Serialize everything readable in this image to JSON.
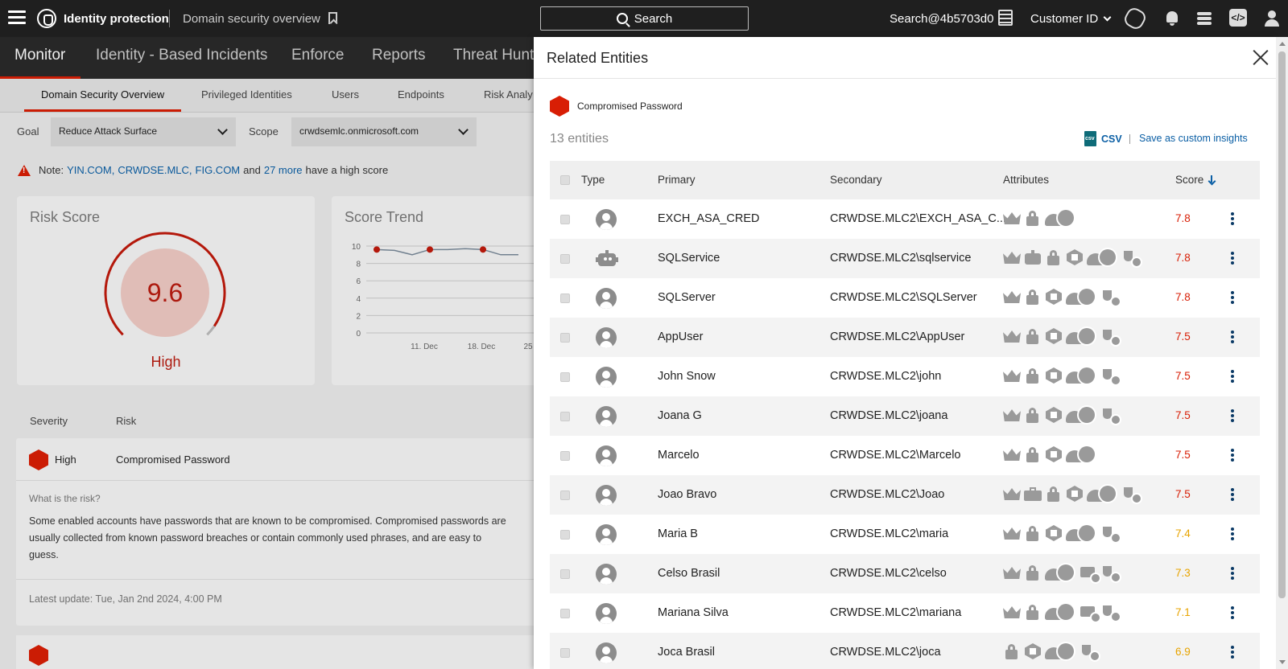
{
  "topbar": {
    "app_name": "Identity protection",
    "page": "Domain security overview",
    "search_label": "Search",
    "account": "Search@4b5703d0",
    "customer_id_label": "Customer ID"
  },
  "main_nav": [
    "Monitor",
    "Identity - Based Incidents",
    "Enforce",
    "Reports",
    "Threat Hunt"
  ],
  "sub_nav": [
    "Domain Security Overview",
    "Privileged Identities",
    "Users",
    "Endpoints",
    "Risk Analy"
  ],
  "filters": {
    "goal_label": "Goal",
    "goal_value": "Reduce Attack Surface",
    "scope_label": "Scope",
    "scope_value": "crwdsemlc.onmicrosoft.com"
  },
  "note": {
    "prefix": "Note:",
    "domain1": "YIN.COM,",
    "domain2": "CRWDSE.MLC,",
    "domain3": "FIG.COM",
    "and": "and",
    "more": "27 more",
    "suffix": "have a high score"
  },
  "risk_score": {
    "title": "Risk Score",
    "value": "9.6",
    "score": 9.6,
    "max": 10,
    "level": "High"
  },
  "score_trend": {
    "title": "Score Trend"
  },
  "chart_data": {
    "type": "line",
    "title": "Score Trend",
    "x": [
      "11. Dec",
      "18. Dec",
      "25"
    ],
    "ylim": [
      0,
      10
    ],
    "yticks": [
      0,
      2,
      4,
      6,
      8,
      10
    ],
    "series": [
      {
        "values": [
          9.6,
          9.5,
          9.0,
          9.6,
          9.6,
          9.7,
          9.6,
          9.0,
          9.0
        ]
      }
    ]
  },
  "risk_table": {
    "severity_header": "Severity",
    "risk_header": "Risk",
    "severity": "High",
    "risk": "Compromised Password",
    "question": "What is the risk?",
    "description": "Some enabled accounts have passwords that are known to be compromised. Compromised passwords are usually collected from known password breaches or contain commonly used phrases, and are easy to guess.",
    "update": "Latest update: Tue, Jan 2nd 2024, 4:00 PM"
  },
  "panel": {
    "title": "Related Entities",
    "filter_tag": "Compromised Password",
    "count": "13 entities",
    "csv_label": "CSV",
    "save_label": "Save as custom insights",
    "columns": {
      "type": "Type",
      "primary": "Primary",
      "secondary": "Secondary",
      "attributes": "Attributes",
      "score": "Score"
    },
    "rows": [
      {
        "type": "person",
        "primary": "EXCH_ASA_CRED",
        "secondary": "CRWDSE.MLC2\\EXCH_ASA_C...",
        "score": "7.8",
        "color": "#d81e05",
        "attrs": [
          "crown",
          "lock",
          "cloudcert"
        ]
      },
      {
        "type": "robot",
        "primary": "SQLService",
        "secondary": "CRWDSE.MLC2\\sqlservice",
        "score": "7.8",
        "color": "#d81e05",
        "attrs": [
          "crown",
          "bot",
          "lock",
          "hexweb",
          "cloudcert",
          "plug"
        ]
      },
      {
        "type": "person",
        "primary": "SQLServer",
        "secondary": "CRWDSE.MLC2\\SQLServer",
        "score": "7.8",
        "color": "#d81e05",
        "attrs": [
          "crown",
          "lock",
          "hexweb",
          "cloudcert",
          "plug"
        ]
      },
      {
        "type": "person",
        "primary": "AppUser",
        "secondary": "CRWDSE.MLC2\\AppUser",
        "score": "7.5",
        "color": "#d81e05",
        "attrs": [
          "crown",
          "lock",
          "hexweb",
          "cloudcert",
          "plug"
        ]
      },
      {
        "type": "person",
        "primary": "John Snow",
        "secondary": "CRWDSE.MLC2\\john",
        "score": "7.5",
        "color": "#d81e05",
        "attrs": [
          "crown",
          "lock",
          "hexweb",
          "cloudcert",
          "plug"
        ]
      },
      {
        "type": "person",
        "primary": "Joana G",
        "secondary": "CRWDSE.MLC2\\joana",
        "score": "7.5",
        "color": "#d81e05",
        "attrs": [
          "crown",
          "lock",
          "hexweb",
          "cloudcert",
          "plug"
        ]
      },
      {
        "type": "person",
        "primary": "Marcelo",
        "secondary": "CRWDSE.MLC2\\Marcelo",
        "score": "7.5",
        "color": "#d81e05",
        "attrs": [
          "crown",
          "lock",
          "hexweb",
          "cloudcert"
        ]
      },
      {
        "type": "person",
        "primary": "Joao Bravo",
        "secondary": "CRWDSE.MLC2\\Joao",
        "score": "7.5",
        "color": "#d81e05",
        "attrs": [
          "crown",
          "briefcase",
          "lock",
          "hexweb",
          "cloudcert",
          "plug"
        ]
      },
      {
        "type": "person",
        "primary": "Maria B",
        "secondary": "CRWDSE.MLC2\\maria",
        "score": "7.4",
        "color": "#e8a400",
        "attrs": [
          "crown",
          "lock",
          "hexweb",
          "cloudcert",
          "plug"
        ]
      },
      {
        "type": "person",
        "primary": "Celso Brasil",
        "secondary": "CRWDSE.MLC2\\celso",
        "score": "7.3",
        "color": "#e8a400",
        "attrs": [
          "crown",
          "lock",
          "cloudcert",
          "cardid",
          "plug"
        ]
      },
      {
        "type": "person",
        "primary": "Mariana Silva",
        "secondary": "CRWDSE.MLC2\\mariana",
        "score": "7.1",
        "color": "#e8a400",
        "attrs": [
          "crown",
          "lock",
          "cloudcert",
          "cardid",
          "plug"
        ]
      },
      {
        "type": "person",
        "primary": "Joca Brasil",
        "secondary": "CRWDSE.MLC2\\joca",
        "score": "6.9",
        "color": "#e8a400",
        "attrs": [
          "lock",
          "hexweb",
          "cloudcert",
          "plug"
        ]
      }
    ]
  }
}
